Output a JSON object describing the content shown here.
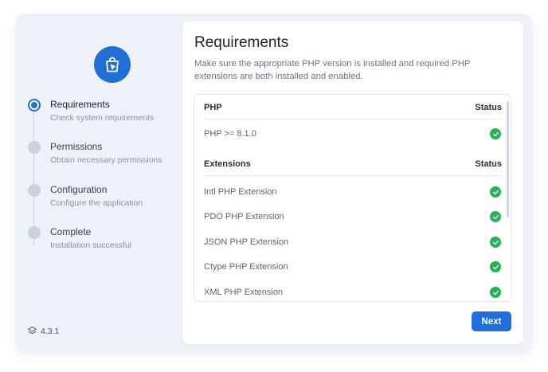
{
  "sidebar": {
    "steps": [
      {
        "title": "Requirements",
        "subtitle": "Check system requirements",
        "active": true
      },
      {
        "title": "Permissions",
        "subtitle": "Obtain necessary permissions",
        "active": false
      },
      {
        "title": "Configuration",
        "subtitle": "Configure the application",
        "active": false
      },
      {
        "title": "Complete",
        "subtitle": "Installation successful",
        "active": false
      }
    ],
    "version": "4.3.1",
    "logo_icon": "shopping-bag-icon",
    "accent_color": "#1f6fd6"
  },
  "main": {
    "title": "Requirements",
    "description": "Make sure the appropriate PHP version is installed and required PHP extensions are both installed and enabled.",
    "php_section": {
      "header": "PHP",
      "status_header": "Status",
      "rows": [
        {
          "name": "PHP >= 8.1.0",
          "status": "check-circle-icon"
        }
      ]
    },
    "extensions_section": {
      "header": "Extensions",
      "status_header": "Status",
      "rows": [
        {
          "name": "Intl PHP Extension",
          "status": "check-circle-icon"
        },
        {
          "name": "PDO PHP Extension",
          "status": "check-circle-icon"
        },
        {
          "name": "JSON PHP Extension",
          "status": "check-circle-icon"
        },
        {
          "name": "Ctype PHP Extension",
          "status": "check-circle-icon"
        },
        {
          "name": "XML PHP Extension",
          "status": "check-circle-icon"
        }
      ]
    },
    "next_label": "Next",
    "success_color": "#22b355",
    "button_color": "#1d6fe0"
  }
}
